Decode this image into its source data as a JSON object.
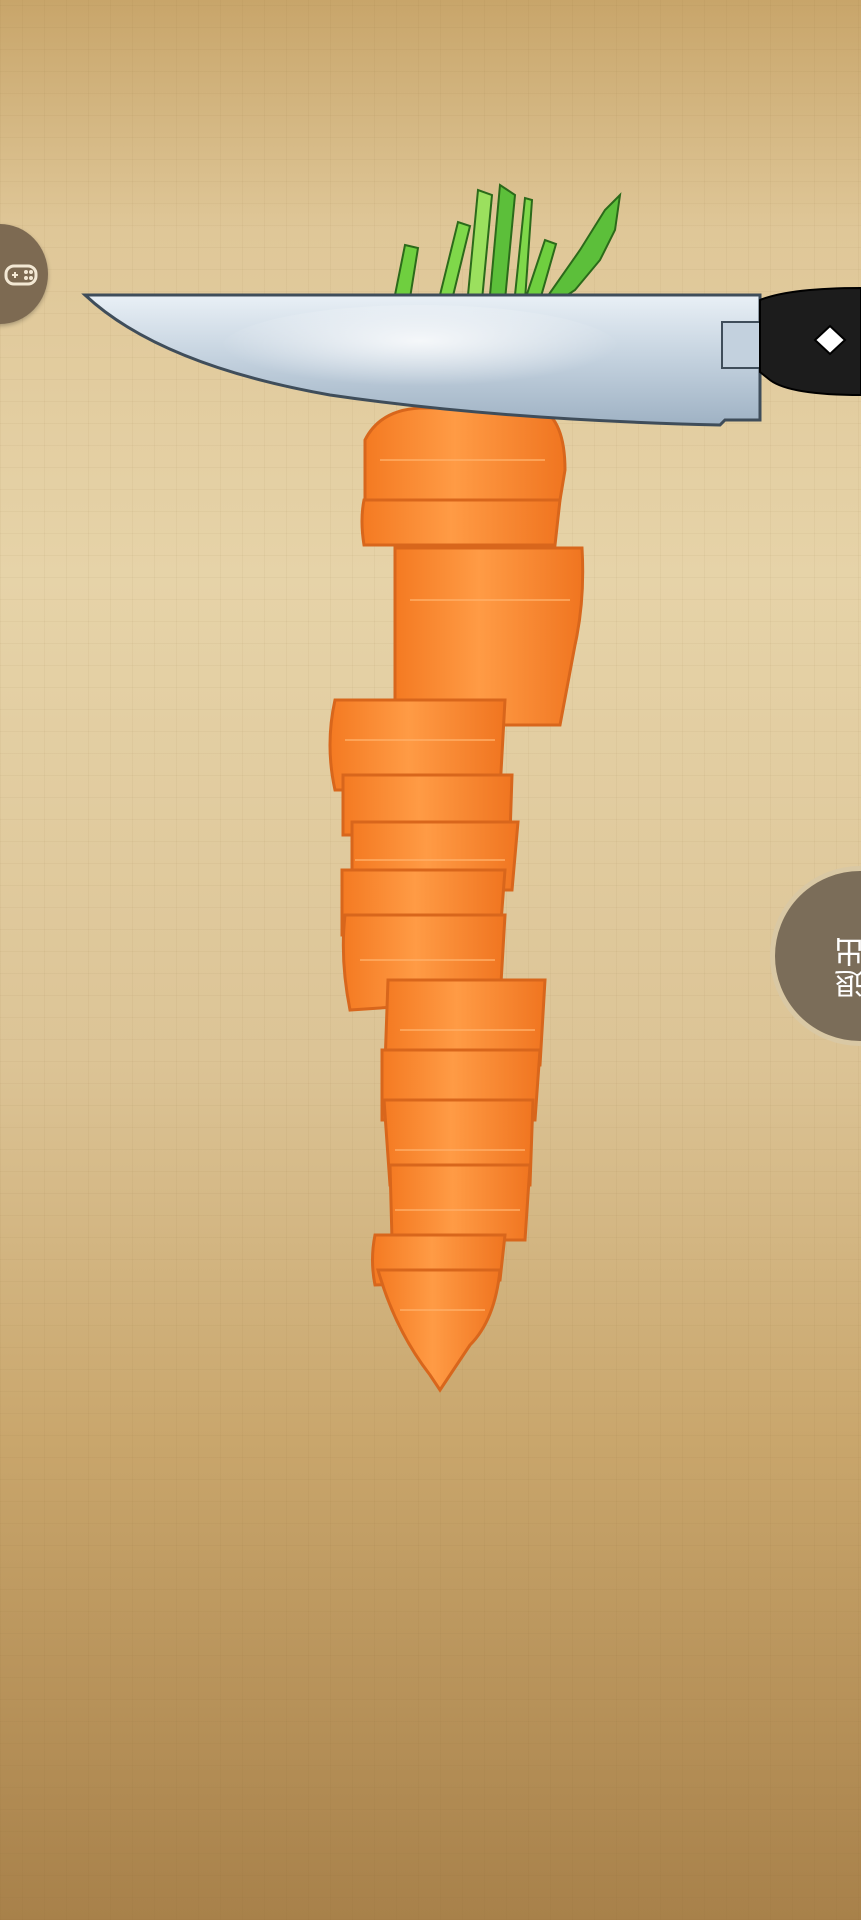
{
  "game": {
    "type": "carrot-slicing",
    "object": "carrot",
    "tool": "knife"
  },
  "controls": {
    "gamepad_icon": "gamepad-icon",
    "exit_label": "退出"
  },
  "colors": {
    "background_top": "#c8a56a",
    "background_mid": "#e6d3a8",
    "background_bottom": "#a8814a",
    "carrot": "#f58a2e",
    "carrot_edge": "#d8661c",
    "leaves": "#5cbf3a",
    "blade": "#c9d7e4",
    "handle": "#1c1c1c",
    "button": "#7b6d59"
  }
}
